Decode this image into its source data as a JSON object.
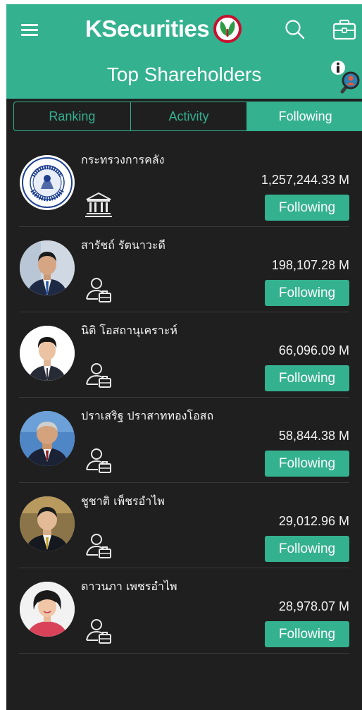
{
  "header": {
    "logo_text": "KSecurities",
    "title": "Top Shareholders",
    "accent_color": "#34b18f",
    "icons": [
      "menu-icon",
      "kbank-leaf-icon",
      "search-icon",
      "briefcase-icon",
      "info-search-icon"
    ]
  },
  "tabs": [
    {
      "label": "Ranking",
      "active": false
    },
    {
      "label": "Activity",
      "active": false
    },
    {
      "label": "Following",
      "active": true
    }
  ],
  "shareholders": [
    {
      "name": "กระทรวงการคลัง",
      "amount": "1,257,244.33 M",
      "button": "Following",
      "type_icon": "government-building-icon",
      "avatar": "ministry-of-finance-seal"
    },
    {
      "name": "สารัชถ์ รัตนาวะดี",
      "amount": "198,107.28 M",
      "button": "Following",
      "type_icon": "person-portfolio-icon",
      "avatar": "person-photo"
    },
    {
      "name": "นิติ โอสถานุเคราะห์",
      "amount": "66,096.09 M",
      "button": "Following",
      "type_icon": "person-portfolio-icon",
      "avatar": "person-photo"
    },
    {
      "name": "ปราเสริฐ ปราสาททองโอสถ",
      "amount": "58,844.38 M",
      "button": "Following",
      "type_icon": "person-portfolio-icon",
      "avatar": "person-photo"
    },
    {
      "name": "ชูชาติ เพ็ชรอำไพ",
      "amount": "29,012.96 M",
      "button": "Following",
      "type_icon": "person-portfolio-icon",
      "avatar": "person-photo"
    },
    {
      "name": "ดาวนภา เพชรอำไพ",
      "amount": "28,978.07 M",
      "button": "Following",
      "type_icon": "person-portfolio-icon",
      "avatar": "person-photo"
    }
  ]
}
